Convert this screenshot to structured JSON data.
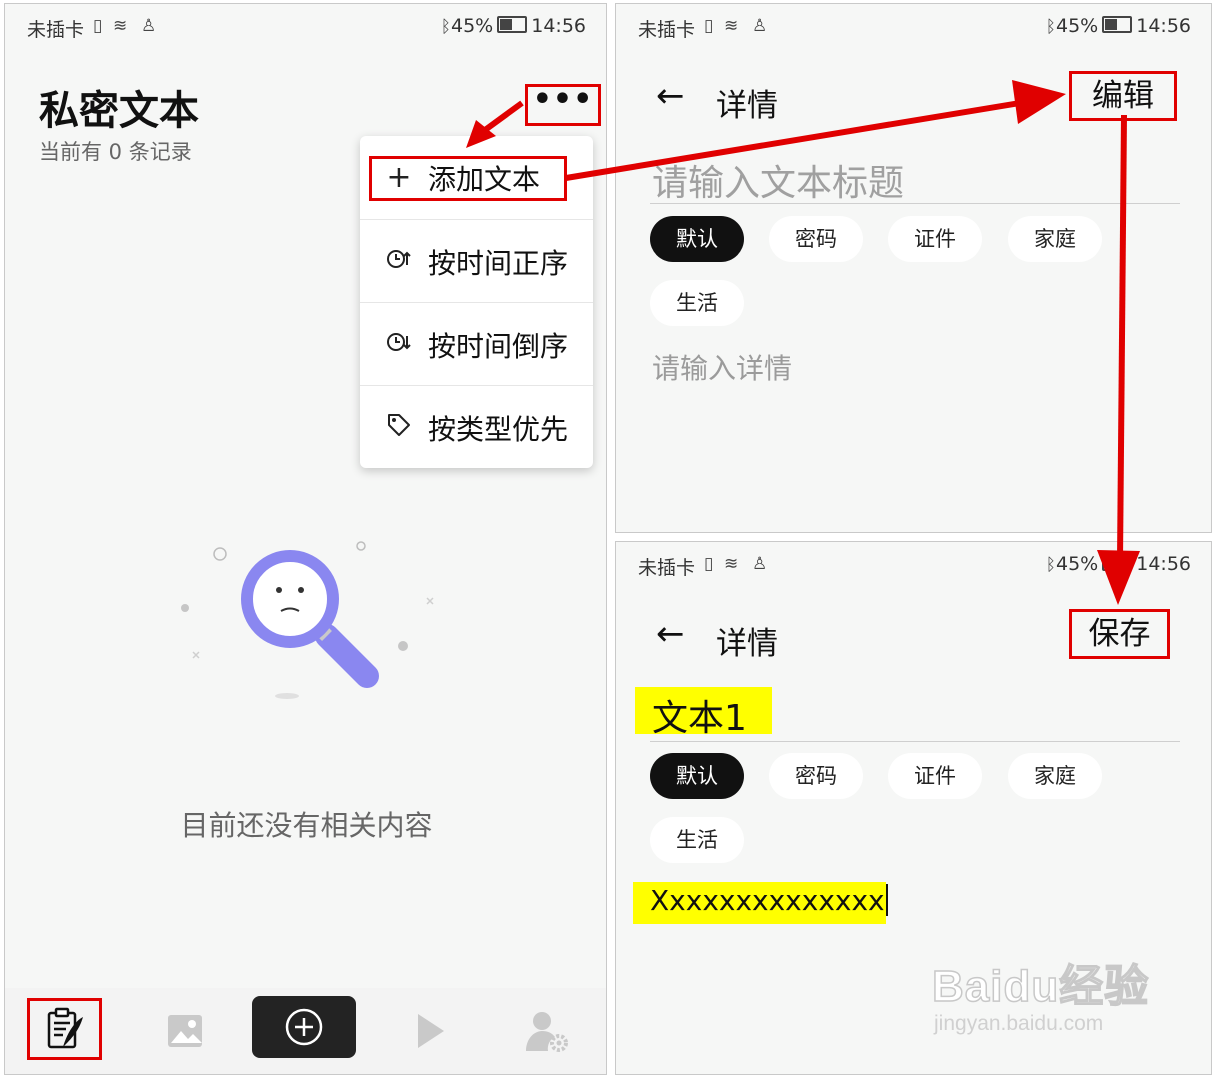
{
  "status": {
    "carrier": "未插卡",
    "battery": "45%",
    "time": "14:56"
  },
  "left": {
    "title": "私密文本",
    "subtitle": "当前有 0 条记录",
    "more_label": "•••",
    "menu": [
      {
        "icon": "plus-icon",
        "label": "添加文本"
      },
      {
        "icon": "clock-ascending-icon",
        "label": "按时间正序"
      },
      {
        "icon": "clock-descending-icon",
        "label": "按时间倒序"
      },
      {
        "icon": "tag-icon",
        "label": "按类型优先"
      }
    ],
    "empty_text": "目前还没有相关内容",
    "bottom_tabs": [
      "notes-icon",
      "image-icon",
      "add-icon",
      "play-icon",
      "user-settings-icon"
    ]
  },
  "edit": {
    "back": "←",
    "header": "详情",
    "action": "编辑",
    "title_placeholder": "请输入文本标题",
    "detail_placeholder": "请输入详情",
    "categories": [
      "默认",
      "密码",
      "证件",
      "家庭",
      "生活"
    ]
  },
  "save": {
    "back": "←",
    "header": "详情",
    "action": "保存",
    "title_value": "文本1",
    "detail_value": "Xxxxxxxxxxxxxx",
    "categories": [
      "默认",
      "密码",
      "证件",
      "家庭",
      "生活"
    ]
  },
  "watermark": {
    "brand": "Baidu经验",
    "url": "jingyan.baidu.com"
  },
  "colors": {
    "annotation_red": "#e00000",
    "highlight_yellow": "#ffff00",
    "accent_purple": "#8a87f0"
  }
}
